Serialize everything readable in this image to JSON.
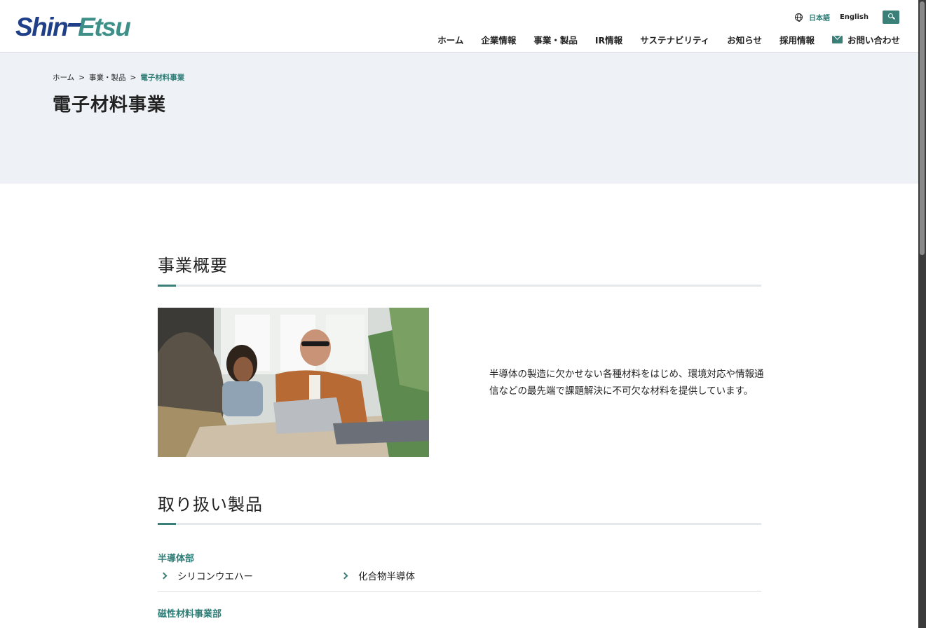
{
  "header": {
    "logo_part1": "Shin",
    "logo_part2": "Etsu",
    "lang_ja": "日本語",
    "lang_en": "English",
    "nav": [
      "ホーム",
      "企業情報",
      "事業・製品",
      "IR情報",
      "サステナビリティ",
      "お知らせ",
      "採用情報",
      "お問い合わせ"
    ],
    "icons": {
      "language": "globe-icon",
      "search": "search-icon",
      "contact": "mail-icon"
    },
    "accent_color": "#3a8079"
  },
  "hero": {
    "breadcrumb": [
      "ホーム",
      "事業・製品",
      "電子材料事業"
    ],
    "separator": ">",
    "title": "電子材料事業"
  },
  "overview": {
    "heading": "事業概要",
    "text": "半導体の製造に欠かせない各種材料をはじめ、環境対応や情報通信などの最先端で課題解決に不可欠な材料を提供しています。"
  },
  "products": {
    "heading": "取り扱い製品",
    "groups": [
      {
        "name": "半導体部",
        "items": [
          "シリコンウエハー",
          "化合物半導体"
        ]
      },
      {
        "name": "磁性材料事業部",
        "items": []
      }
    ]
  }
}
